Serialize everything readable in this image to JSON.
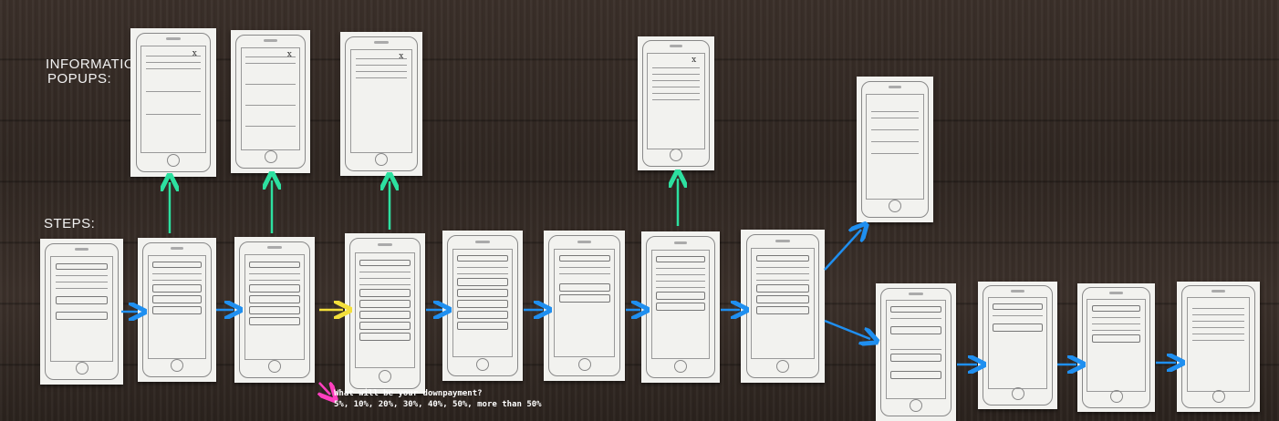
{
  "labels": {
    "information_popups_line1": "INFORMATION",
    "information_popups_line2": "POPUPS:",
    "steps": "STEPS:"
  },
  "annotation": {
    "line1": "What will be your downpayment?",
    "line2": "5%, 10%, 20%, 30%, 40%, 50%, more than 50%"
  },
  "colors": {
    "teal_arrow": "#2de0a0",
    "blue_arrow": "#1f8ff0",
    "yellow_arrow": "#f3df3a",
    "magenta_arrow": "#ff3fbf"
  }
}
